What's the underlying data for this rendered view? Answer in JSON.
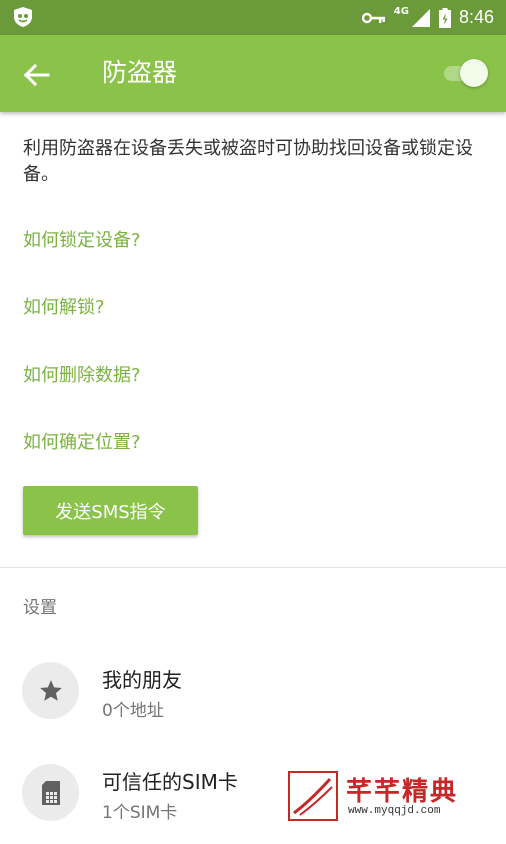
{
  "status_bar": {
    "time": "8:46",
    "network": "4G",
    "icons": [
      "app-shield-icon",
      "vpn-key-icon",
      "signal-icon",
      "battery-icon"
    ]
  },
  "app_bar": {
    "title": "防盗器",
    "toggle_on": true,
    "color": "#8bc34a"
  },
  "main": {
    "description": "利用防盗器在设备丢失或被盗时可协助找回设备或锁定设备。",
    "links": [
      {
        "label": "如何锁定设备?"
      },
      {
        "label": "如何解锁?"
      },
      {
        "label": "如何删除数据?"
      },
      {
        "label": "如何确定位置?"
      }
    ],
    "sms_button": "发送SMS指令",
    "link_color": "#7cb342"
  },
  "settings": {
    "section_label": "设置",
    "items": [
      {
        "title": "我的朋友",
        "subtitle": "0个地址",
        "icon": "star-icon"
      },
      {
        "title": "可信任的SIM卡",
        "subtitle": "1个SIM卡",
        "icon": "sim-card-icon"
      }
    ]
  },
  "watermark": {
    "title": "芊芊精典",
    "url": "www.myqqjd.com"
  }
}
